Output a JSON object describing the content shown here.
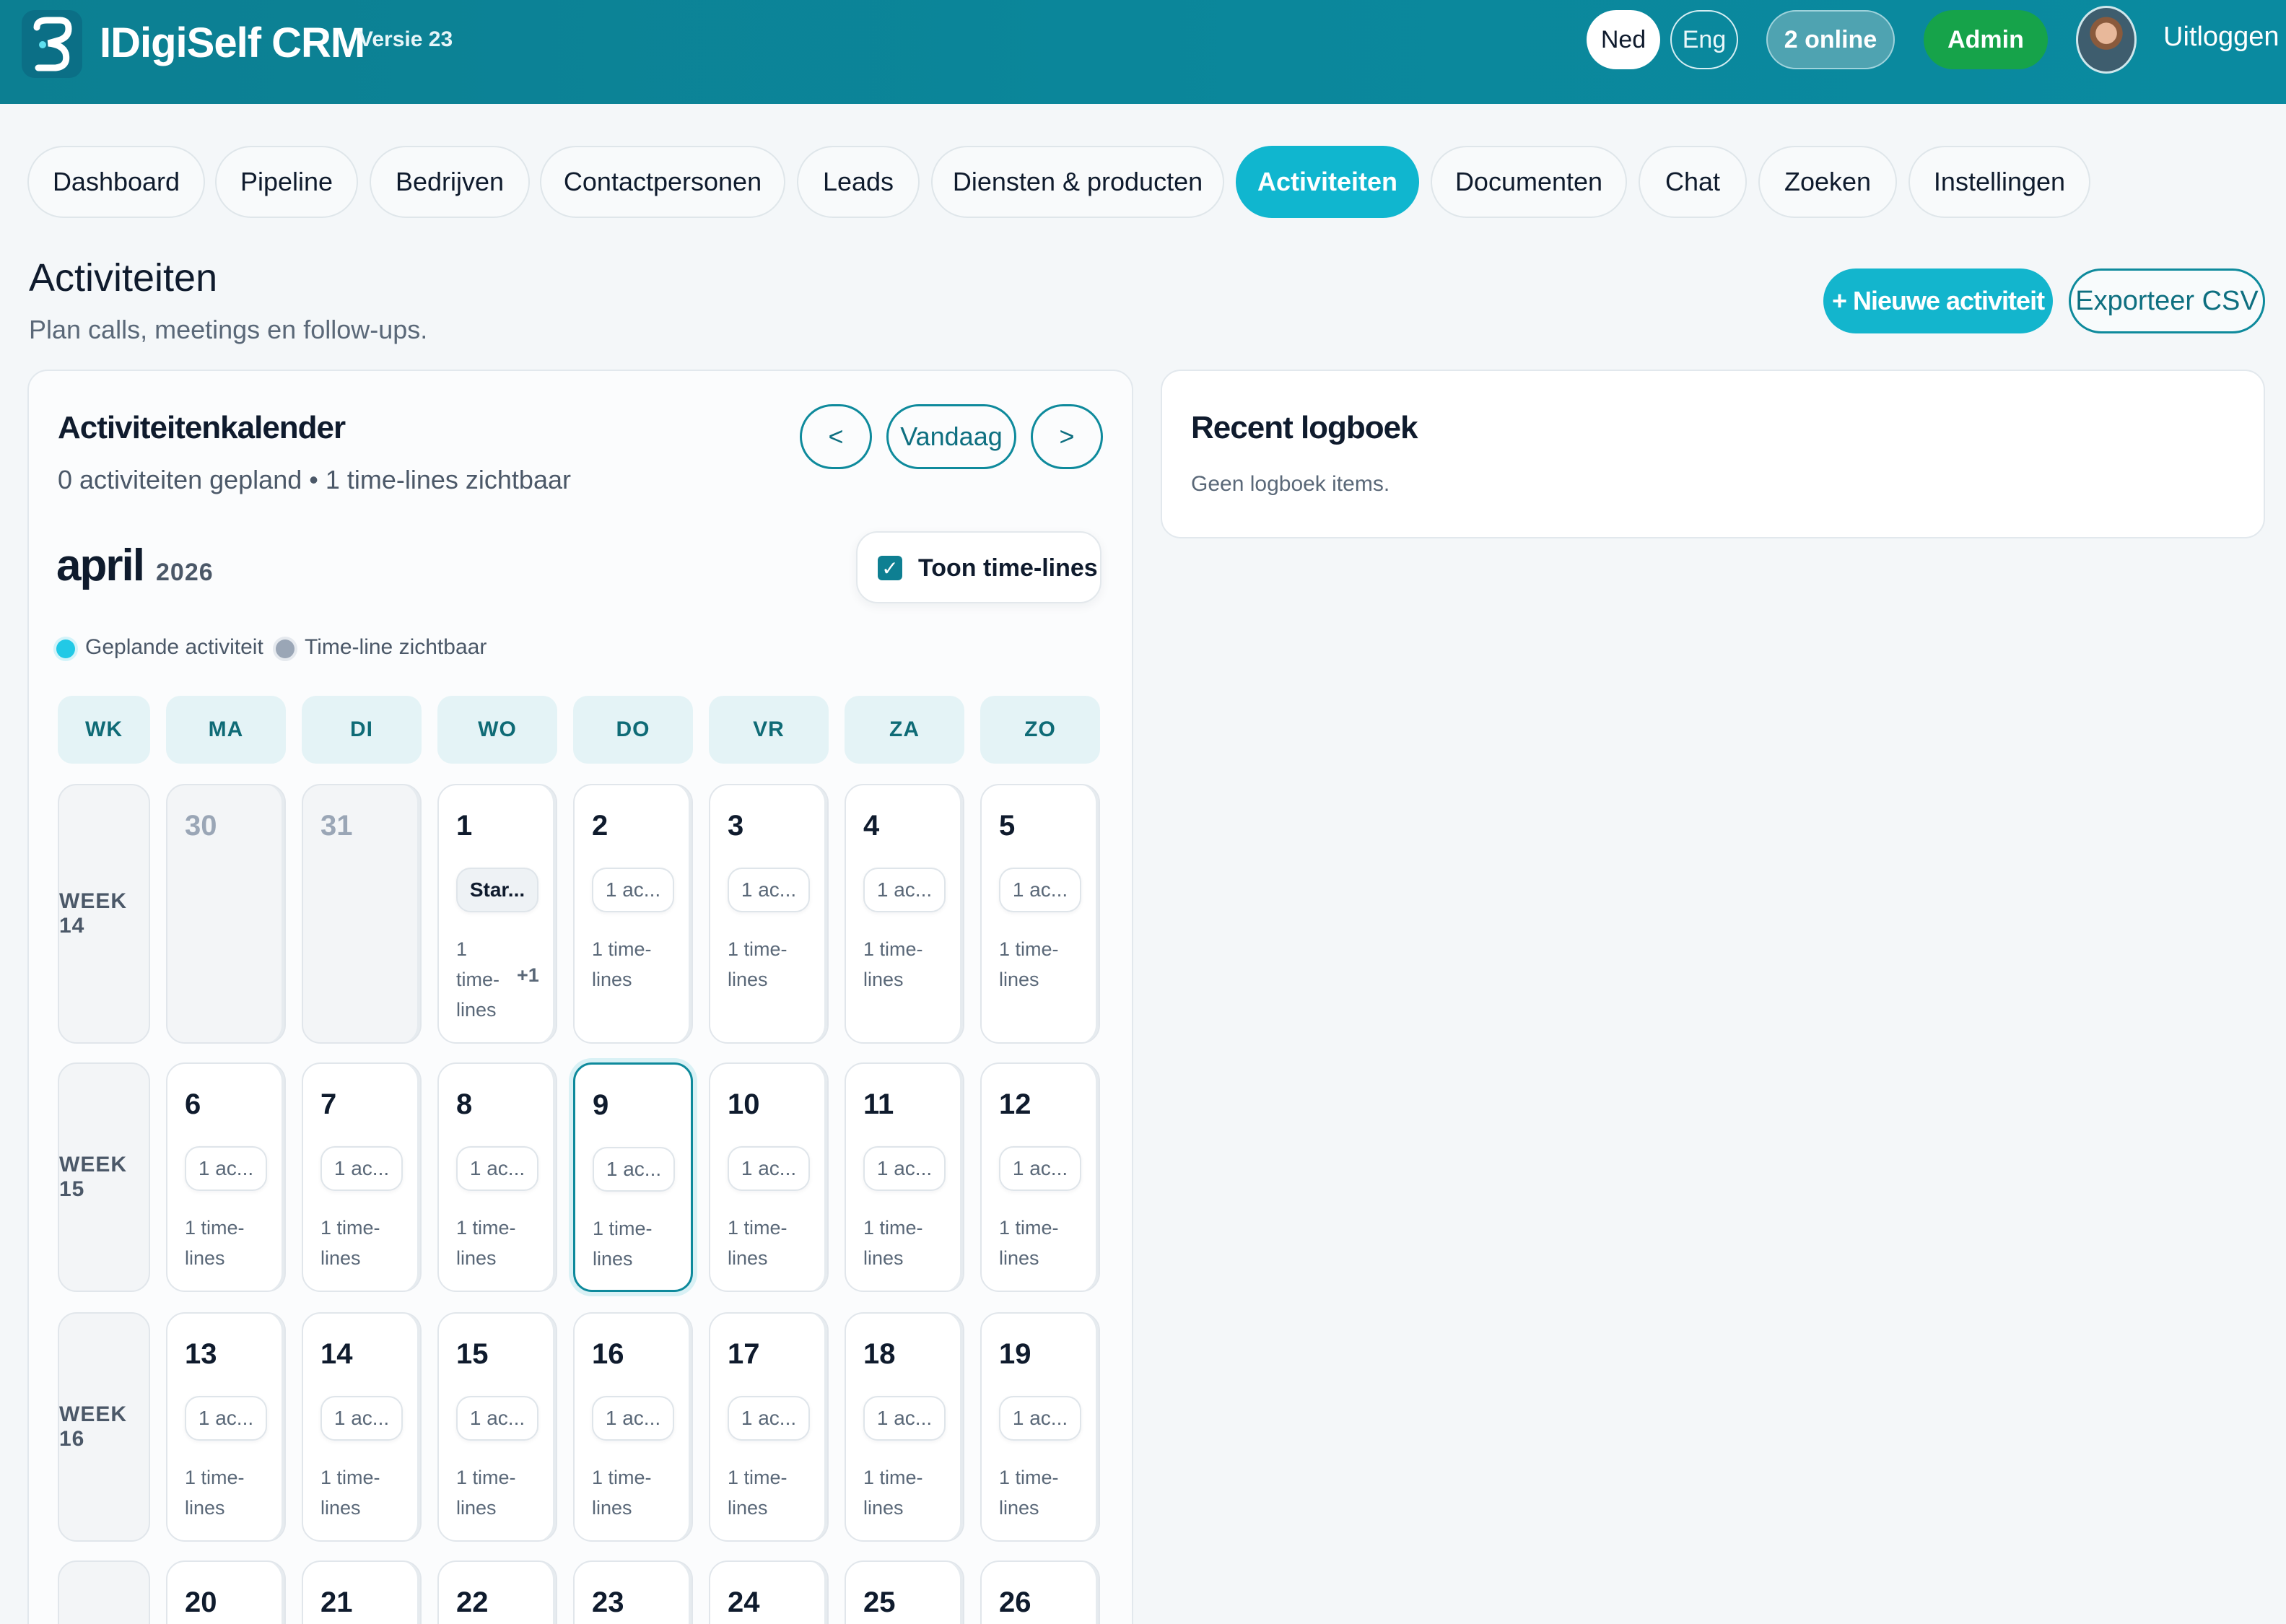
{
  "header": {
    "app_name": "IDigiSelf CRM",
    "version": "Versie 23",
    "lang_ned": "Ned",
    "lang_eng": "Eng",
    "online": "2 online",
    "admin": "Admin",
    "logout": "Uitloggen"
  },
  "nav": {
    "tabs": [
      {
        "label": "Dashboard"
      },
      {
        "label": "Pipeline"
      },
      {
        "label": "Bedrijven"
      },
      {
        "label": "Contactpersonen"
      },
      {
        "label": "Leads"
      },
      {
        "label": "Diensten & producten"
      },
      {
        "label": "Activiteiten"
      },
      {
        "label": "Documenten"
      },
      {
        "label": "Chat"
      },
      {
        "label": "Zoeken"
      },
      {
        "label": "Instellingen"
      }
    ],
    "active": "Activiteiten"
  },
  "page": {
    "title": "Activiteiten",
    "subtitle": "Plan calls, meetings en follow-ups.",
    "new_button": "+ Nieuwe activiteit",
    "export_button": "Exporteer CSV"
  },
  "calendar": {
    "title": "Activiteitenkalender",
    "summary": "0 activiteiten gepland • 1 time-lines zichtbaar",
    "prev": "<",
    "today": "Vandaag",
    "next": ">",
    "month": "april",
    "year": "2026",
    "toggle_label": "Toon time-lines",
    "legend_planned": "Geplande activiteit",
    "legend_timeline": "Time-line zichtbaar",
    "columns": [
      "WK",
      "MA",
      "DI",
      "WO",
      "DO",
      "VR",
      "ZA",
      "ZO"
    ],
    "weeks": [
      {
        "label": "WEEK 14",
        "days": [
          {
            "num": "30",
            "muted": true
          },
          {
            "num": "31",
            "muted": true
          },
          {
            "num": "1",
            "chip": "Star...",
            "tl": "1 time-lines",
            "extra": "+1",
            "start": true
          },
          {
            "num": "2",
            "chip": "1 ac...",
            "tl": "1 time-lines"
          },
          {
            "num": "3",
            "chip": "1 ac...",
            "tl": "1 time-lines"
          },
          {
            "num": "4",
            "chip": "1 ac...",
            "tl": "1 time-lines"
          },
          {
            "num": "5",
            "chip": "1 ac...",
            "tl": "1 time-lines"
          }
        ]
      },
      {
        "label": "WEEK 15",
        "days": [
          {
            "num": "6",
            "chip": "1 ac...",
            "tl": "1 time-lines"
          },
          {
            "num": "7",
            "chip": "1 ac...",
            "tl": "1 time-lines"
          },
          {
            "num": "8",
            "chip": "1 ac...",
            "tl": "1 time-lines"
          },
          {
            "num": "9",
            "chip": "1 ac...",
            "tl": "1 time-lines",
            "today": true
          },
          {
            "num": "10",
            "chip": "1 ac...",
            "tl": "1 time-lines"
          },
          {
            "num": "11",
            "chip": "1 ac...",
            "tl": "1 time-lines"
          },
          {
            "num": "12",
            "chip": "1 ac...",
            "tl": "1 time-lines"
          }
        ]
      },
      {
        "label": "WEEK 16",
        "days": [
          {
            "num": "13",
            "chip": "1 ac...",
            "tl": "1 time-lines"
          },
          {
            "num": "14",
            "chip": "1 ac...",
            "tl": "1 time-lines"
          },
          {
            "num": "15",
            "chip": "1 ac...",
            "tl": "1 time-lines"
          },
          {
            "num": "16",
            "chip": "1 ac...",
            "tl": "1 time-lines"
          },
          {
            "num": "17",
            "chip": "1 ac...",
            "tl": "1 time-lines"
          },
          {
            "num": "18",
            "chip": "1 ac...",
            "tl": "1 time-lines"
          },
          {
            "num": "19",
            "chip": "1 ac...",
            "tl": "1 time-lines"
          }
        ]
      },
      {
        "label": "",
        "days": [
          {
            "num": "20"
          },
          {
            "num": "21"
          },
          {
            "num": "22"
          },
          {
            "num": "23"
          },
          {
            "num": "24"
          },
          {
            "num": "25"
          },
          {
            "num": "26"
          }
        ]
      }
    ]
  },
  "log": {
    "title": "Recent logboek",
    "empty": "Geen logboek items."
  },
  "colors": {
    "header": "#0b879b",
    "accent": "#13b5cd",
    "admin": "#16a34a",
    "outline": "#0e8a9c"
  }
}
